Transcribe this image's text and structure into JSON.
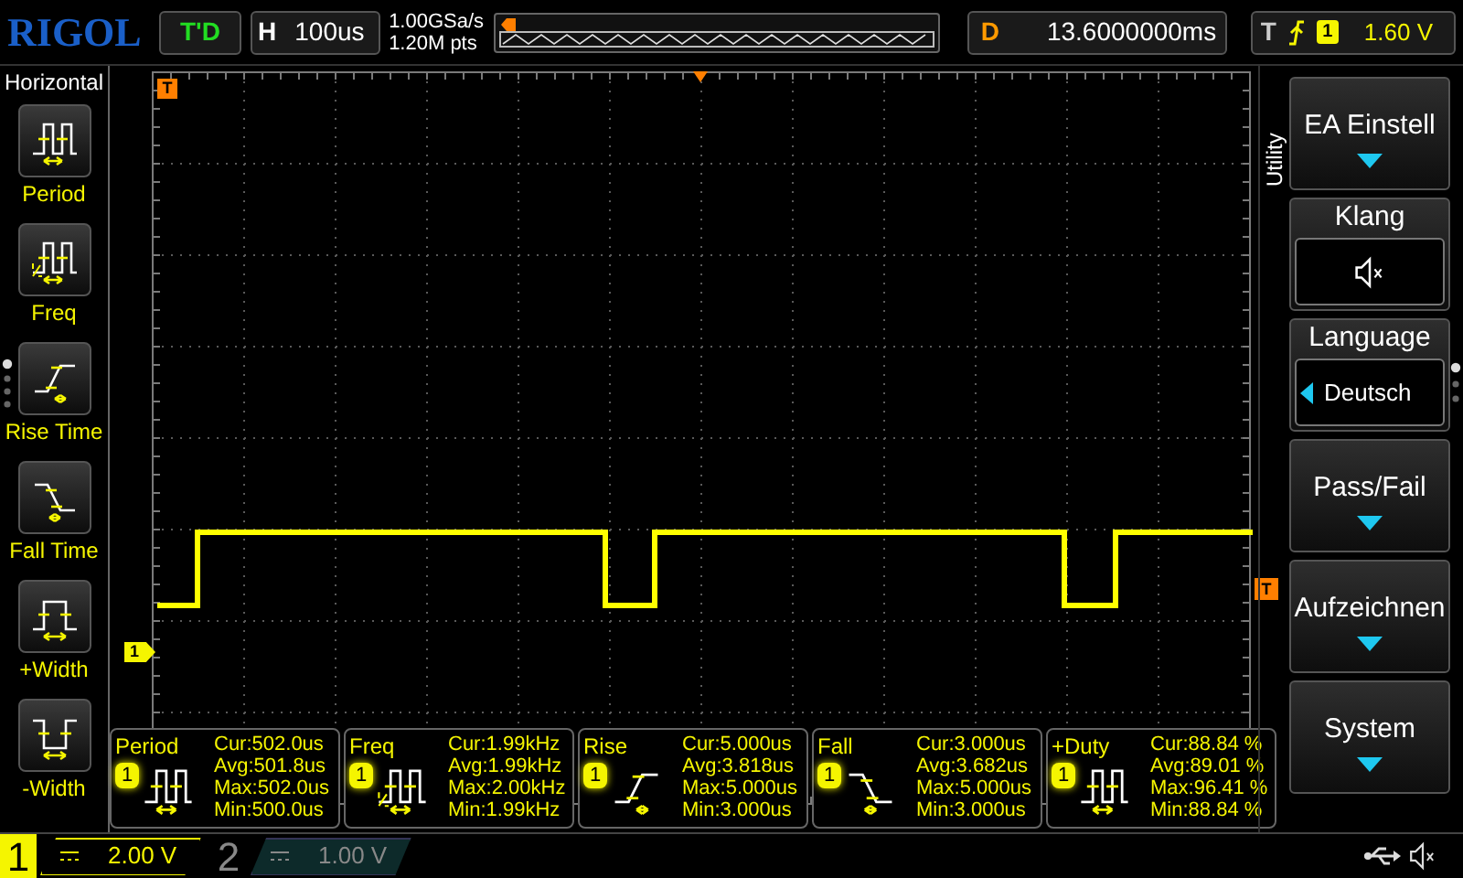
{
  "top_bar": {
    "logo": "RIGOL",
    "run_status": "T'D",
    "horizontal": {
      "label": "H",
      "value": "100us"
    },
    "sample_rate": "1.00GSa/s",
    "memory_depth": "1.20M pts",
    "delay": {
      "label": "D",
      "value": "13.6000000ms"
    },
    "trigger": {
      "label": "T",
      "source": "1",
      "level": "1.60 V"
    }
  },
  "left_menu": {
    "title": "Horizontal",
    "items": [
      {
        "kind": "period",
        "label": "Period"
      },
      {
        "kind": "freq",
        "label": "Freq"
      },
      {
        "kind": "rise",
        "label": "Rise Time"
      },
      {
        "kind": "fall",
        "label": "Fall Time"
      },
      {
        "kind": "pwidth",
        "label": "+Width"
      },
      {
        "kind": "nwidth",
        "label": "-Width"
      }
    ]
  },
  "markers": {
    "trigger_position": "T",
    "channel": "1",
    "trigger_level": "T"
  },
  "measurements": [
    {
      "kind": "period",
      "name": "Period",
      "source": "1",
      "cur": "Cur:502.0us",
      "avg": "Avg:501.8us",
      "max": "Max:502.0us",
      "min": "Min:500.0us"
    },
    {
      "kind": "freq",
      "name": "Freq",
      "source": "1",
      "cur": "Cur:1.99kHz",
      "avg": "Avg:1.99kHz",
      "max": "Max:2.00kHz",
      "min": "Min:1.99kHz"
    },
    {
      "kind": "rise",
      "name": "Rise",
      "source": "1",
      "cur": "Cur:5.000us",
      "avg": "Avg:3.818us",
      "max": "Max:5.000us",
      "min": "Min:3.000us"
    },
    {
      "kind": "fall",
      "name": "Fall",
      "source": "1",
      "cur": "Cur:3.000us",
      "avg": "Avg:3.682us",
      "max": "Max:5.000us",
      "min": "Min:3.000us"
    },
    {
      "kind": "period",
      "name": "+Duty",
      "source": "1",
      "cur": "Cur:88.84 %",
      "avg": "Avg:89.01 %",
      "max": "Max:96.41 %",
      "min": "Min:88.84 %"
    }
  ],
  "right_menu": {
    "title": "Utility",
    "items": [
      {
        "kind": "submenu",
        "label": "EA Einstell"
      },
      {
        "kind": "mute",
        "label": "Klang"
      },
      {
        "kind": "choice",
        "label": "Language",
        "value": "Deutsch"
      },
      {
        "kind": "submenu",
        "label": "Pass/Fail"
      },
      {
        "kind": "submenu",
        "label": "Aufzeichnen"
      },
      {
        "kind": "submenu",
        "label": "System"
      }
    ]
  },
  "channels": [
    {
      "number": "1",
      "scale": "2.00 V",
      "on": true
    },
    {
      "number": "2",
      "scale": "1.00 V",
      "on": false
    }
  ]
}
